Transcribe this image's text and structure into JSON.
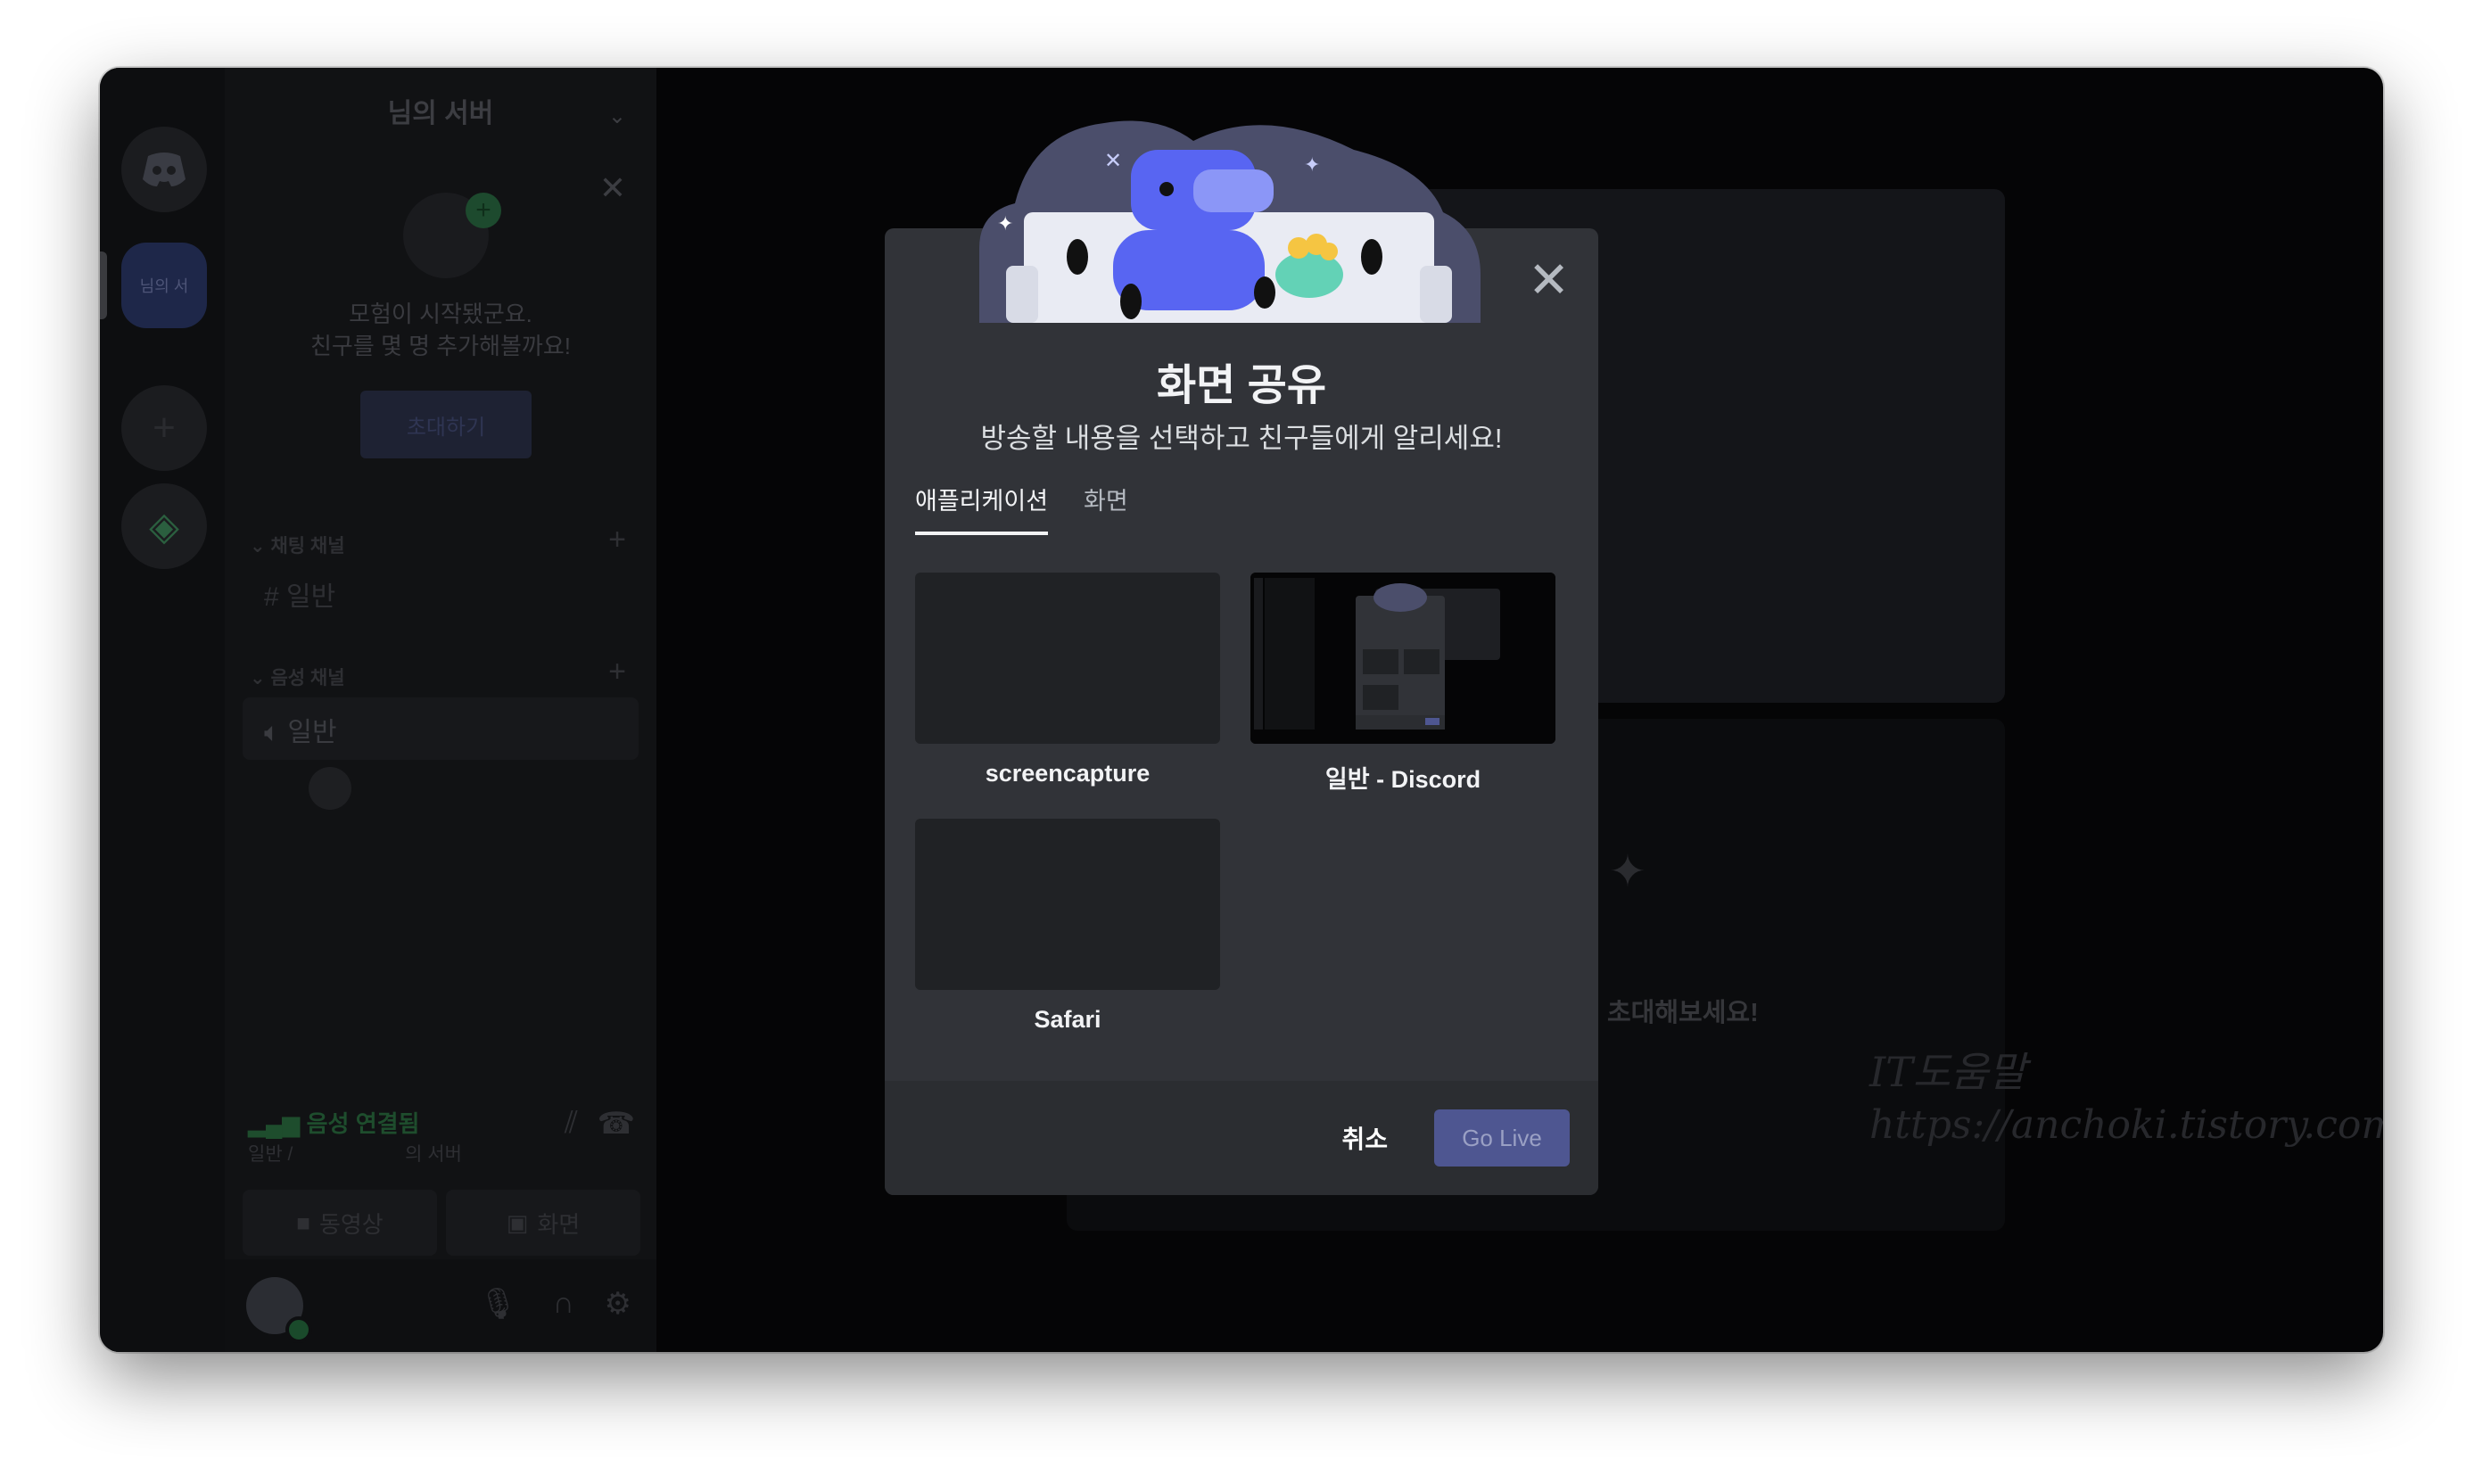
{
  "sidebar": {
    "server_name": "님의 서버",
    "rail_server_label": "님의 서",
    "empty_line1": "모험이 시작됐군요.",
    "empty_line2": "친구를 몇 명 추가해볼까요!",
    "invite_button": "초대하기",
    "text_category": "채팅 채널",
    "text_channel": "일반",
    "voice_category": "음성 채널",
    "voice_channel": "일반",
    "voice_status": "음성 연결됨",
    "voice_location_prefix": "일반 /",
    "voice_location_suffix": "의 서버",
    "video_button": "동영상",
    "screen_button": "화면"
  },
  "main": {
    "invite_text": "초대해보세요!",
    "watermark_line1": "IT도움말",
    "watermark_line2": "https://anchoki.tistory.com"
  },
  "modal": {
    "title": "화면 공유",
    "subtitle": "방송할 내용을 선택하고 친구들에게 알리세요!",
    "tabs": [
      "애플리케이션",
      "화면"
    ],
    "sources": [
      {
        "label": "screencapture"
      },
      {
        "label": "일반 - Discord"
      },
      {
        "label": "Safari"
      }
    ],
    "cancel_label": "취소",
    "go_live_label": "Go Live"
  },
  "colors": {
    "modal_bg": "#313338",
    "go_live_bg": "#4e5691",
    "traffic_red": "#fe5f57",
    "traffic_yellow": "#febc2e",
    "traffic_green": "#28c840"
  }
}
